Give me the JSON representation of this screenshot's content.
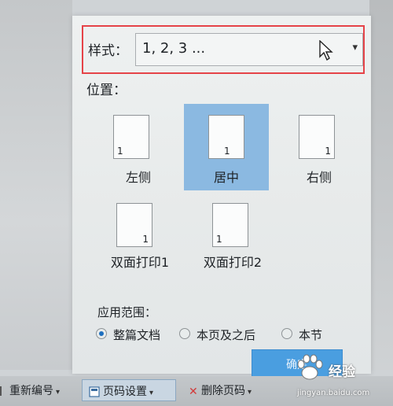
{
  "dialog": {
    "style_label": "样式：",
    "style_value": "1, 2, 3 ...",
    "position_label": "位置：",
    "positions": [
      {
        "label": "左侧",
        "num": "1"
      },
      {
        "label": "居中",
        "num": "1",
        "selected": true
      },
      {
        "label": "右侧",
        "num": "1"
      },
      {
        "label": "双面打印1",
        "num": "1"
      },
      {
        "label": "双面打印2",
        "num": "1"
      }
    ],
    "range_label": "应用范围：",
    "range_options": [
      {
        "label": "整篇文档",
        "selected": true
      },
      {
        "label": "本页及之后",
        "selected": false
      },
      {
        "label": "本节",
        "selected": false
      }
    ],
    "ok_label": "确定"
  },
  "taskbar": {
    "renumber": "重新编号",
    "page_settings": "页码设置",
    "delete_page_num": "删除页码"
  },
  "watermark": {
    "brand": "经验",
    "url": "jingyan.baidu.com"
  },
  "colors": {
    "highlight": "#e54348",
    "selection": "#8bb9e1",
    "button": "#4a9ee0",
    "radio_on": "#1d6fbf"
  },
  "icons": [
    "cursor-icon",
    "dropdown-arrow-icon",
    "page-settings-icon",
    "delete-icon",
    "baidu-paw-icon"
  ]
}
